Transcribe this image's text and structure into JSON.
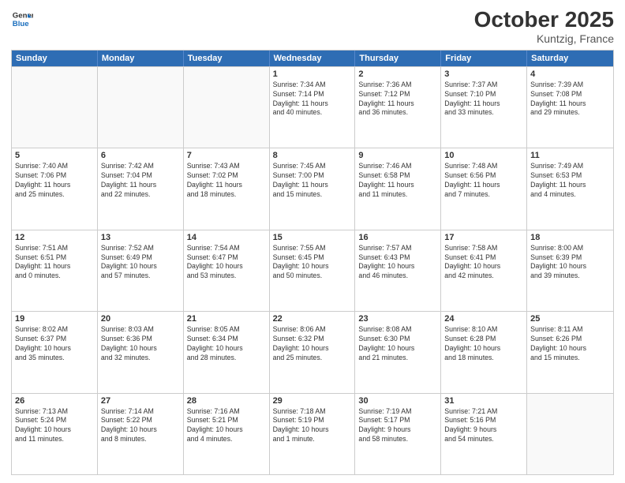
{
  "header": {
    "logo_line1": "General",
    "logo_line2": "Blue",
    "month": "October 2025",
    "location": "Kuntzig, France"
  },
  "weekdays": [
    "Sunday",
    "Monday",
    "Tuesday",
    "Wednesday",
    "Thursday",
    "Friday",
    "Saturday"
  ],
  "rows": [
    [
      {
        "day": "",
        "info": ""
      },
      {
        "day": "",
        "info": ""
      },
      {
        "day": "",
        "info": ""
      },
      {
        "day": "1",
        "info": "Sunrise: 7:34 AM\nSunset: 7:14 PM\nDaylight: 11 hours\nand 40 minutes."
      },
      {
        "day": "2",
        "info": "Sunrise: 7:36 AM\nSunset: 7:12 PM\nDaylight: 11 hours\nand 36 minutes."
      },
      {
        "day": "3",
        "info": "Sunrise: 7:37 AM\nSunset: 7:10 PM\nDaylight: 11 hours\nand 33 minutes."
      },
      {
        "day": "4",
        "info": "Sunrise: 7:39 AM\nSunset: 7:08 PM\nDaylight: 11 hours\nand 29 minutes."
      }
    ],
    [
      {
        "day": "5",
        "info": "Sunrise: 7:40 AM\nSunset: 7:06 PM\nDaylight: 11 hours\nand 25 minutes."
      },
      {
        "day": "6",
        "info": "Sunrise: 7:42 AM\nSunset: 7:04 PM\nDaylight: 11 hours\nand 22 minutes."
      },
      {
        "day": "7",
        "info": "Sunrise: 7:43 AM\nSunset: 7:02 PM\nDaylight: 11 hours\nand 18 minutes."
      },
      {
        "day": "8",
        "info": "Sunrise: 7:45 AM\nSunset: 7:00 PM\nDaylight: 11 hours\nand 15 minutes."
      },
      {
        "day": "9",
        "info": "Sunrise: 7:46 AM\nSunset: 6:58 PM\nDaylight: 11 hours\nand 11 minutes."
      },
      {
        "day": "10",
        "info": "Sunrise: 7:48 AM\nSunset: 6:56 PM\nDaylight: 11 hours\nand 7 minutes."
      },
      {
        "day": "11",
        "info": "Sunrise: 7:49 AM\nSunset: 6:53 PM\nDaylight: 11 hours\nand 4 minutes."
      }
    ],
    [
      {
        "day": "12",
        "info": "Sunrise: 7:51 AM\nSunset: 6:51 PM\nDaylight: 11 hours\nand 0 minutes."
      },
      {
        "day": "13",
        "info": "Sunrise: 7:52 AM\nSunset: 6:49 PM\nDaylight: 10 hours\nand 57 minutes."
      },
      {
        "day": "14",
        "info": "Sunrise: 7:54 AM\nSunset: 6:47 PM\nDaylight: 10 hours\nand 53 minutes."
      },
      {
        "day": "15",
        "info": "Sunrise: 7:55 AM\nSunset: 6:45 PM\nDaylight: 10 hours\nand 50 minutes."
      },
      {
        "day": "16",
        "info": "Sunrise: 7:57 AM\nSunset: 6:43 PM\nDaylight: 10 hours\nand 46 minutes."
      },
      {
        "day": "17",
        "info": "Sunrise: 7:58 AM\nSunset: 6:41 PM\nDaylight: 10 hours\nand 42 minutes."
      },
      {
        "day": "18",
        "info": "Sunrise: 8:00 AM\nSunset: 6:39 PM\nDaylight: 10 hours\nand 39 minutes."
      }
    ],
    [
      {
        "day": "19",
        "info": "Sunrise: 8:02 AM\nSunset: 6:37 PM\nDaylight: 10 hours\nand 35 minutes."
      },
      {
        "day": "20",
        "info": "Sunrise: 8:03 AM\nSunset: 6:36 PM\nDaylight: 10 hours\nand 32 minutes."
      },
      {
        "day": "21",
        "info": "Sunrise: 8:05 AM\nSunset: 6:34 PM\nDaylight: 10 hours\nand 28 minutes."
      },
      {
        "day": "22",
        "info": "Sunrise: 8:06 AM\nSunset: 6:32 PM\nDaylight: 10 hours\nand 25 minutes."
      },
      {
        "day": "23",
        "info": "Sunrise: 8:08 AM\nSunset: 6:30 PM\nDaylight: 10 hours\nand 21 minutes."
      },
      {
        "day": "24",
        "info": "Sunrise: 8:10 AM\nSunset: 6:28 PM\nDaylight: 10 hours\nand 18 minutes."
      },
      {
        "day": "25",
        "info": "Sunrise: 8:11 AM\nSunset: 6:26 PM\nDaylight: 10 hours\nand 15 minutes."
      }
    ],
    [
      {
        "day": "26",
        "info": "Sunrise: 7:13 AM\nSunset: 5:24 PM\nDaylight: 10 hours\nand 11 minutes."
      },
      {
        "day": "27",
        "info": "Sunrise: 7:14 AM\nSunset: 5:22 PM\nDaylight: 10 hours\nand 8 minutes."
      },
      {
        "day": "28",
        "info": "Sunrise: 7:16 AM\nSunset: 5:21 PM\nDaylight: 10 hours\nand 4 minutes."
      },
      {
        "day": "29",
        "info": "Sunrise: 7:18 AM\nSunset: 5:19 PM\nDaylight: 10 hours\nand 1 minute."
      },
      {
        "day": "30",
        "info": "Sunrise: 7:19 AM\nSunset: 5:17 PM\nDaylight: 9 hours\nand 58 minutes."
      },
      {
        "day": "31",
        "info": "Sunrise: 7:21 AM\nSunset: 5:16 PM\nDaylight: 9 hours\nand 54 minutes."
      },
      {
        "day": "",
        "info": ""
      }
    ]
  ]
}
